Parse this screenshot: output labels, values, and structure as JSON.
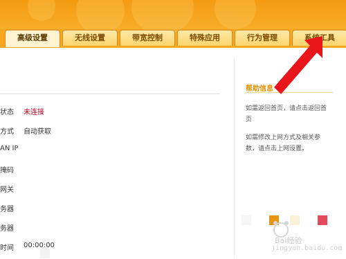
{
  "tabs": [
    {
      "label": "高级设置",
      "active": true
    },
    {
      "label": "无线设置",
      "active": false
    },
    {
      "label": "带宽控制",
      "active": false
    },
    {
      "label": "特殊应用",
      "active": false
    },
    {
      "label": "行为管理",
      "active": false
    },
    {
      "label": "系统工具",
      "active": false
    }
  ],
  "status_rows": [
    {
      "label": "状态",
      "value": "未连接"
    },
    {
      "label": "方式",
      "value": "自动获取"
    },
    {
      "label": "AN IP",
      "value": ""
    },
    {
      "label": "掩码",
      "value": ""
    },
    {
      "label": "网关",
      "value": ""
    },
    {
      "label": "务器",
      "value": ""
    },
    {
      "label": "务器",
      "value": ""
    },
    {
      "label": "时间",
      "value": "00:00:00"
    }
  ],
  "help": {
    "title": "帮助信息",
    "text1_line1": "如需返回首页，请点击返回首",
    "text1_line2": "页",
    "text2_line1": "如需修改上网方式及相关参",
    "text2_line2": "数，请点击上网设置。"
  },
  "colors": {
    "header": "#f7a31b",
    "accent": "#e09000",
    "status_red": "#b3001b",
    "arrow": "#e8161b"
  },
  "watermark": {
    "text": "Bai经验",
    "url": "jingyan.baidu.com"
  }
}
